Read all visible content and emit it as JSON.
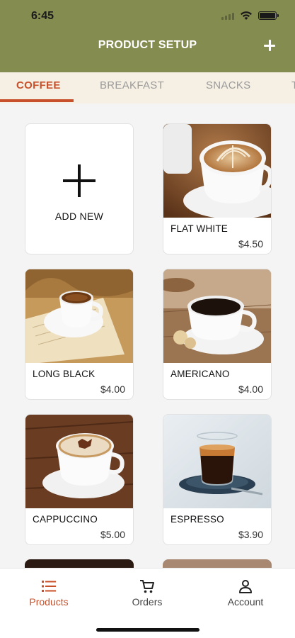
{
  "status_bar": {
    "time": "6:45"
  },
  "header": {
    "title": "PRODUCT SETUP",
    "add_icon": "plus-icon"
  },
  "tabs": [
    {
      "label": "COFFEE",
      "active": true
    },
    {
      "label": "BREAKFAST",
      "active": false
    },
    {
      "label": "SNACKS",
      "active": false
    },
    {
      "label": "T",
      "active": false
    }
  ],
  "add_card": {
    "label": "ADD NEW"
  },
  "products": [
    {
      "name": "FLAT WHITE",
      "price": "$4.50"
    },
    {
      "name": "LONG BLACK",
      "price": "$4.00"
    },
    {
      "name": "AMERICANO",
      "price": "$4.00"
    },
    {
      "name": "CAPPUCCINO",
      "price": "$5.00"
    },
    {
      "name": "ESPRESSO",
      "price": "$3.90"
    }
  ],
  "bottom_nav": [
    {
      "label": "Products",
      "icon": "list-icon",
      "active": true
    },
    {
      "label": "Orders",
      "icon": "cart-icon",
      "active": false
    },
    {
      "label": "Account",
      "icon": "user-icon",
      "active": false
    }
  ],
  "colors": {
    "header": "#858c50",
    "accent": "#c8502a",
    "tab_bar": "#f6efe3"
  }
}
